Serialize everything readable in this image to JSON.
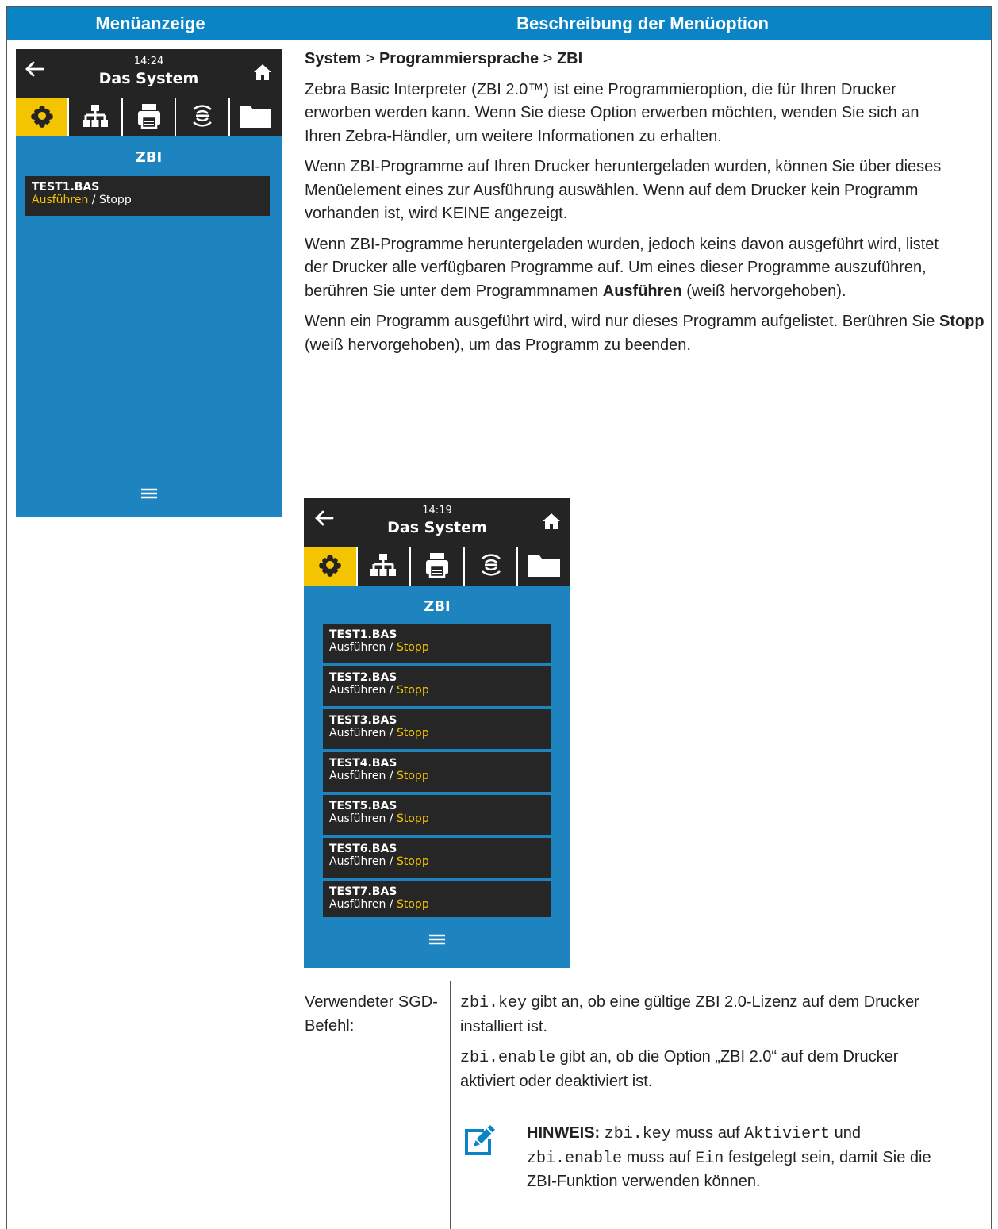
{
  "table": {
    "col1_header": "Menüanzeige",
    "col2_header": "Beschreibung der Menüoption"
  },
  "screen1": {
    "time": "14:24",
    "title": "Das System",
    "section": "ZBI",
    "items": [
      {
        "name": "TEST1.BAS",
        "run": "Ausführen",
        "sep": " / ",
        "stop": "Stopp",
        "highlight": "run"
      }
    ]
  },
  "screen2": {
    "time": "14:19",
    "title": "Das System",
    "section": "ZBI",
    "items": [
      {
        "name": "TEST1.BAS",
        "run": "Ausführen",
        "sep": " / ",
        "stop": "Stopp",
        "highlight": "stop"
      },
      {
        "name": "TEST2.BAS",
        "run": "Ausführen",
        "sep": " / ",
        "stop": "Stopp",
        "highlight": "stop"
      },
      {
        "name": "TEST3.BAS",
        "run": "Ausführen",
        "sep": " / ",
        "stop": "Stopp",
        "highlight": "stop"
      },
      {
        "name": "TEST4.BAS",
        "run": "Ausführen",
        "sep": " / ",
        "stop": "Stopp",
        "highlight": "stop"
      },
      {
        "name": "TEST5.BAS",
        "run": "Ausführen",
        "sep": " / ",
        "stop": "Stopp",
        "highlight": "stop"
      },
      {
        "name": "TEST6.BAS",
        "run": "Ausführen",
        "sep": " / ",
        "stop": "Stopp",
        "highlight": "stop"
      },
      {
        "name": "TEST7.BAS",
        "run": "Ausführen",
        "sep": " / ",
        "stop": "Stopp",
        "highlight": "stop"
      }
    ]
  },
  "description": {
    "path": {
      "p1": "System",
      "sep1": " > ",
      "p2": "Programmiersprache",
      "sep2": " > ",
      "p3": "ZBI"
    },
    "para1": "Zebra Basic Interpreter (ZBI 2.0™) ist eine Programmieroption, die für Ihren Drucker erworben werden kann. Wenn Sie diese Option erwerben möchten, wenden Sie sich an Ihren Zebra-Händler, um weitere Informationen zu erhalten.",
    "para2": "Wenn ZBI-Programme auf Ihren Drucker heruntergeladen wurden, können Sie über dieses Menüelement eines zur Ausführung auswählen. Wenn auf dem Drucker kein Programm vorhanden ist, wird KEINE angezeigt.",
    "para3_a": "Wenn ZBI-Programme heruntergeladen wurden, jedoch keins davon ausgeführt wird, listet der Drucker alle verfügbaren Programme auf. Um eines dieser Programme auszuführen, berühren Sie unter dem Programmnamen ",
    "para3_b": "Ausführen",
    "para3_c": " (weiß hervorgehoben).",
    "para4_a": "Wenn ein Programm ausgeführt wird, wird nur dieses Programm aufgelistet. Berühren Sie ",
    "para4_b": "Stopp",
    "para4_c": " (weiß hervorgehoben), um das Programm zu beenden."
  },
  "sgd": {
    "label": "Verwendeter SGD-Befehl:",
    "cmd1_code": "zbi.key",
    "cmd1_text": " gibt an, ob eine gültige ZBI 2.0-Lizenz auf dem Drucker installiert ist.",
    "cmd2_code": "zbi.enable",
    "cmd2_text": " gibt an, ob die Option „ZBI 2.0“ auf dem Drucker aktiviert oder deaktiviert ist.",
    "note_label": "HINWEIS:",
    "note_code1": "zbi.key",
    "note_t1": " muss auf ",
    "note_code2": "Aktiviert",
    "note_t2": " und ",
    "note_code3": "zbi.enable",
    "note_t3": " muss auf ",
    "note_code4": "Ein",
    "note_t4": " festgelegt sein, damit Sie die ZBI-Funktion verwenden können."
  },
  "icons": [
    "back-arrow-icon",
    "home-icon",
    "gear-icon",
    "network-icon",
    "printer-icon",
    "wireless-icon",
    "folder-icon",
    "menu-icon",
    "note-edit-icon"
  ],
  "colors": {
    "header_blue": "#0b84c6",
    "screen_blue": "#1d84c0",
    "tab_active": "#f5c400",
    "dark": "#242424"
  }
}
